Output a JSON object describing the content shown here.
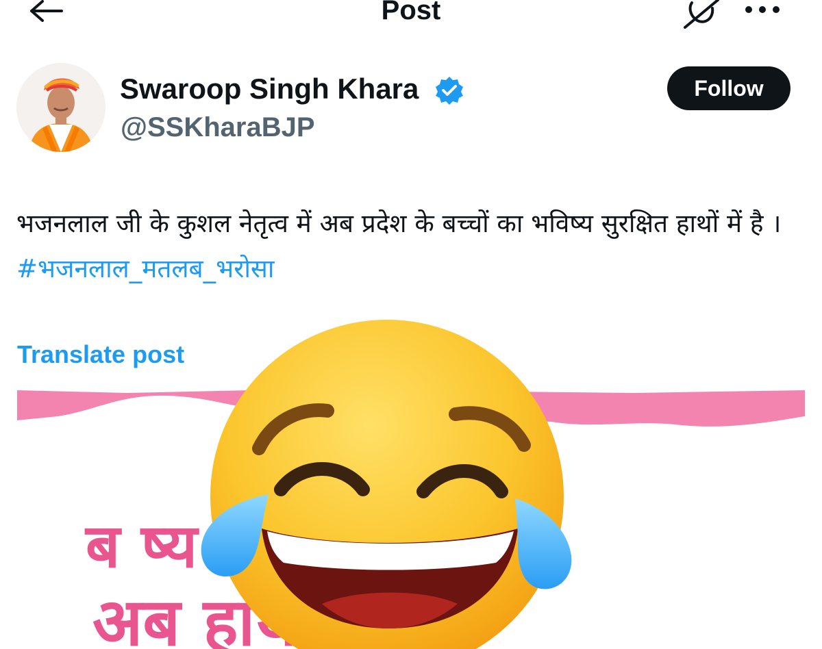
{
  "header": {
    "title": "Post",
    "back_icon": "arrow-left-icon",
    "grok_icon": "grok-icon",
    "more_icon": "more-horizontal-icon"
  },
  "author": {
    "display_name": "Swaroop Singh Khara",
    "handle": "@SSKharaBJP",
    "verified_icon": "verified-badge-icon",
    "verified_color": "#1d9bf0",
    "follow_label": "Follow"
  },
  "post": {
    "text": "भजनलाल जी के कुशल नेतृत्व में अब प्रदेश के बच्चों का भविष्य सुरक्षित हाथों में है । ",
    "hashtag": "#भजनलाल_मतलब_भरोसा",
    "hashtag_color": "#1d9bf0",
    "translate_label": "Translate post"
  },
  "media": {
    "image_text_line_1": "ब                          ष्य",
    "image_text_line_2": "अब                        हाथों में",
    "accent_color": "#e9558f",
    "overlay_icon": "face-with-tears-of-joy-icon"
  }
}
